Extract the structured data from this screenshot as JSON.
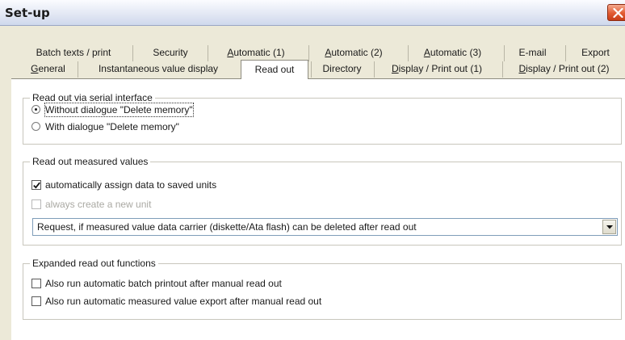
{
  "window": {
    "title": "Set-up"
  },
  "tabs": {
    "back_row": [
      {
        "label": "Batch texts / print"
      },
      {
        "label": "Security"
      },
      {
        "mnemonic": "A",
        "rest": "utomatic (1)"
      },
      {
        "mnemonic": "A",
        "rest": "utomatic (2)"
      },
      {
        "mnemonic": "A",
        "rest": "utomatic (3)"
      },
      {
        "label": "E-mail"
      },
      {
        "label": "Export"
      }
    ],
    "front_row": [
      {
        "mnemonic": "G",
        "rest": "eneral"
      },
      {
        "label": "Instantaneous value display"
      },
      {
        "label": "Read out"
      },
      {
        "label": "Directory"
      },
      {
        "mnemonic": "D",
        "rest": "isplay / Print out (1)"
      },
      {
        "mnemonic": "D",
        "rest": "isplay / Print out (2)"
      }
    ],
    "active": "Read out"
  },
  "serial": {
    "title": "Read out via serial interface",
    "options": [
      {
        "label": "Without dialogue \"Delete memory\"",
        "checked": true
      },
      {
        "label": "With dialogue \"Delete memory\"",
        "checked": false
      }
    ]
  },
  "measured": {
    "title": "Read out measured values",
    "auto_assign": {
      "label": "automatically assign data to saved units",
      "checked": true
    },
    "new_unit": {
      "label": "always create a new unit",
      "checked": false,
      "disabled": true
    },
    "dropdown": {
      "value": "Request, if measured value data carrier (diskette/Ata flash) can be deleted after read out"
    }
  },
  "expanded": {
    "title": "Expanded read out functions",
    "batch_printout": {
      "label": "Also run automatic batch printout after manual read out",
      "checked": false
    },
    "value_export": {
      "label": "Also run automatic measured value export after manual read out",
      "checked": false
    }
  },
  "colors": {
    "body": "#ece9d8",
    "panel": "#ffffff",
    "close": "#e25b32"
  },
  "icons": {
    "close": "close-icon",
    "dropdown": "chevron-down-icon",
    "check": "checkmark-icon"
  }
}
